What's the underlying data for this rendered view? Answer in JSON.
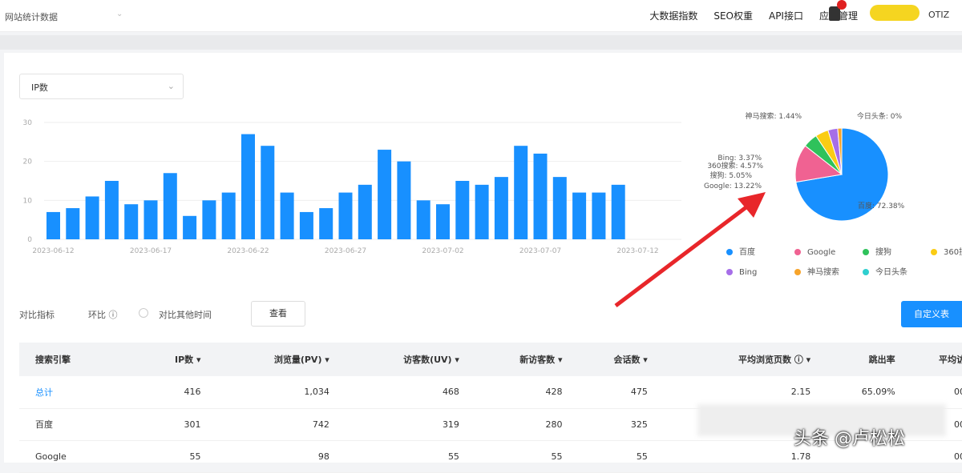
{
  "header": {
    "site": "网站统计数据",
    "nav": [
      "大数据指数",
      "SEO权重",
      "API接口",
      "应用管理"
    ],
    "user": "OTIZ"
  },
  "metric_select": "IP数",
  "chart_data": [
    {
      "type": "bar",
      "color": "#1890ff",
      "yticks": [
        0,
        10,
        20,
        30
      ],
      "ylim": [
        0,
        30
      ],
      "categories": [
        "2023-06-12",
        "2023-06-13",
        "2023-06-14",
        "2023-06-15",
        "2023-06-16",
        "2023-06-17",
        "2023-06-18",
        "2023-06-19",
        "2023-06-20",
        "2023-06-21",
        "2023-06-22",
        "2023-06-23",
        "2023-06-24",
        "2023-06-25",
        "2023-06-26",
        "2023-06-27",
        "2023-06-28",
        "2023-06-29",
        "2023-06-30",
        "2023-07-01",
        "2023-07-02",
        "2023-07-03",
        "2023-07-04",
        "2023-07-05",
        "2023-07-06",
        "2023-07-07",
        "2023-07-08",
        "2023-07-09",
        "2023-07-10",
        "2023-07-11"
      ],
      "xtick_labels": [
        "2023-06-12",
        "2023-06-17",
        "2023-06-22",
        "2023-06-27",
        "2023-07-02",
        "2023-07-07",
        "2023-07-12"
      ],
      "values": [
        7,
        8,
        11,
        15,
        9,
        10,
        17,
        6,
        10,
        12,
        27,
        24,
        12,
        7,
        8,
        12,
        14,
        23,
        20,
        10,
        9,
        15,
        14,
        16,
        24,
        22,
        16,
        12,
        12,
        14
      ]
    },
    {
      "type": "pie",
      "slices": [
        {
          "name": "百度",
          "value": 72.38,
          "label": "百度: 72.38%",
          "color": "#1890ff"
        },
        {
          "name": "Google",
          "value": 13.22,
          "label": "Google: 13.22%",
          "color": "#f06292"
        },
        {
          "name": "搜狗",
          "value": 5.05,
          "label": "搜狗: 5.05%",
          "color": "#2fc25b"
        },
        {
          "name": "360搜索",
          "value": 4.57,
          "label": "360搜索: 4.57%",
          "color": "#facc14"
        },
        {
          "name": "Bing",
          "value": 3.37,
          "label": "Bing: 3.37%",
          "color": "#a66ee8"
        },
        {
          "name": "神马搜索",
          "value": 1.44,
          "label": "神马搜索: 1.44%",
          "color": "#f7a42a"
        },
        {
          "name": "今日头条",
          "value": 0,
          "label": "今日头条: 0%",
          "color": "#2fcfcf"
        }
      ],
      "legend": "bottom"
    }
  ],
  "controls": {
    "compare_label": "对比指标",
    "mom": "环比 ⓘ",
    "other_time": "对比其他时间",
    "view": "查看",
    "custom": "自定义表"
  },
  "table": {
    "headers": [
      "搜索引擎",
      "IP数 ▾",
      "浏览量(PV) ▾",
      "访客数(UV) ▾",
      "新访客数 ▾",
      "会话数 ▾",
      "平均浏览页数 ⓘ ▾",
      "跳出率",
      "平均访"
    ],
    "rows": [
      [
        "总计",
        "416",
        "1,034",
        "468",
        "428",
        "475",
        "2.15",
        "65.09%",
        "00"
      ],
      [
        "百度",
        "301",
        "742",
        "319",
        "280",
        "325",
        "",
        "",
        "00"
      ],
      [
        "Google",
        "55",
        "98",
        "55",
        "55",
        "55",
        "1.78",
        "",
        "00"
      ]
    ]
  },
  "watermark": "头条 @卢松松"
}
